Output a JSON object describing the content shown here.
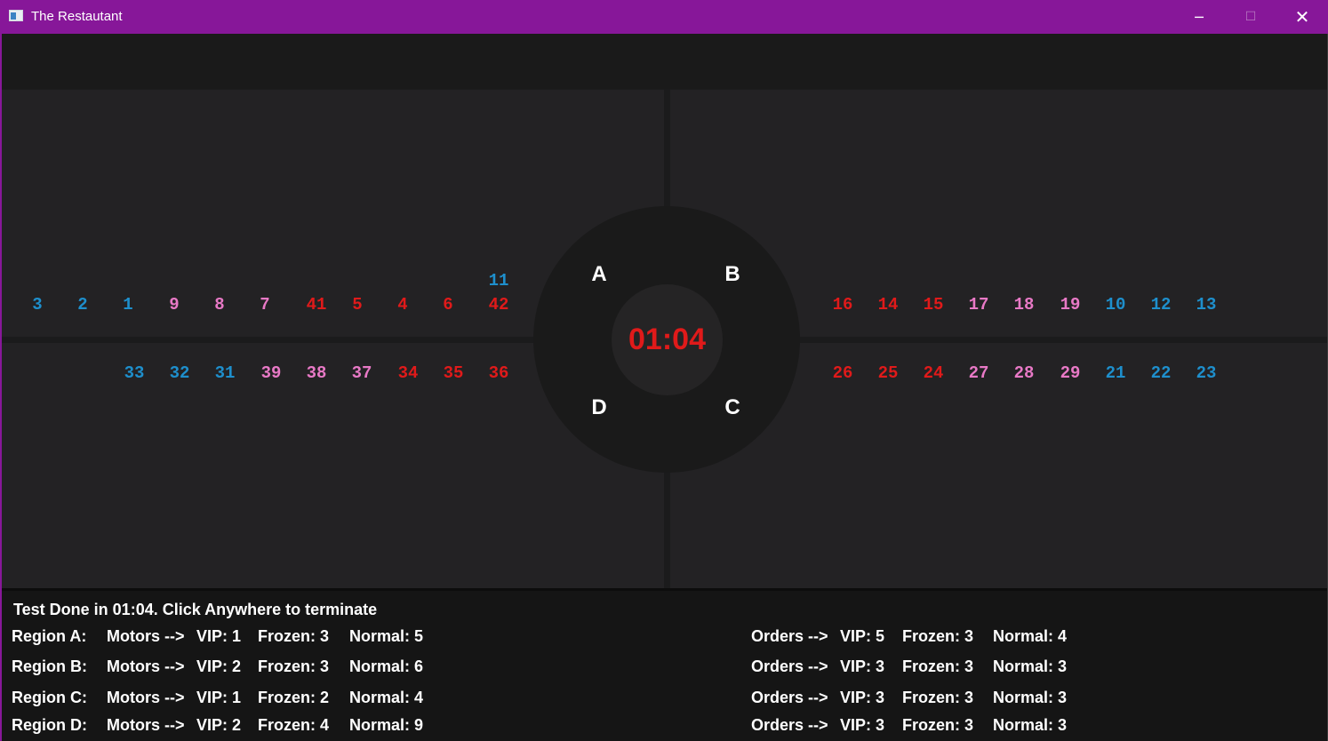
{
  "window": {
    "title": "The Restautant",
    "minimize_glyph": "─",
    "maximize_glyph": "☐",
    "close_glyph": "✕"
  },
  "colors": {
    "titlebar": "#871799",
    "vip": "#1e8fcc",
    "frozen": "#e879c6",
    "normal": "#e01a1a",
    "timer": "#e01a1a"
  },
  "timer": "01:04",
  "regions": {
    "a": "A",
    "b": "B",
    "c": "C",
    "d": "D"
  },
  "tables": {
    "top_left": [
      {
        "label": "3",
        "kind": "vip"
      },
      {
        "label": "2",
        "kind": "vip"
      },
      {
        "label": "1",
        "kind": "vip"
      },
      {
        "label": "9",
        "kind": "frozen"
      },
      {
        "label": "8",
        "kind": "frozen"
      },
      {
        "label": "7",
        "kind": "frozen"
      },
      {
        "label": "41",
        "kind": "normal"
      },
      {
        "label": "5",
        "kind": "normal"
      },
      {
        "label": "4",
        "kind": "normal"
      },
      {
        "label": "6",
        "kind": "normal"
      },
      {
        "label": "42",
        "kind": "normal"
      }
    ],
    "top_left_extra": {
      "label": "11",
      "kind": "vip"
    },
    "bottom_left": [
      {
        "label": "33",
        "kind": "vip"
      },
      {
        "label": "32",
        "kind": "vip"
      },
      {
        "label": "31",
        "kind": "vip"
      },
      {
        "label": "39",
        "kind": "frozen"
      },
      {
        "label": "38",
        "kind": "frozen"
      },
      {
        "label": "37",
        "kind": "frozen"
      },
      {
        "label": "34",
        "kind": "normal"
      },
      {
        "label": "35",
        "kind": "normal"
      },
      {
        "label": "36",
        "kind": "normal"
      }
    ],
    "top_right": [
      {
        "label": "16",
        "kind": "normal"
      },
      {
        "label": "14",
        "kind": "normal"
      },
      {
        "label": "15",
        "kind": "normal"
      },
      {
        "label": "17",
        "kind": "frozen"
      },
      {
        "label": "18",
        "kind": "frozen"
      },
      {
        "label": "19",
        "kind": "frozen"
      },
      {
        "label": "10",
        "kind": "vip"
      },
      {
        "label": "12",
        "kind": "vip"
      },
      {
        "label": "13",
        "kind": "vip"
      }
    ],
    "bottom_right": [
      {
        "label": "26",
        "kind": "normal"
      },
      {
        "label": "25",
        "kind": "normal"
      },
      {
        "label": "24",
        "kind": "normal"
      },
      {
        "label": "27",
        "kind": "frozen"
      },
      {
        "label": "28",
        "kind": "frozen"
      },
      {
        "label": "29",
        "kind": "frozen"
      },
      {
        "label": "21",
        "kind": "vip"
      },
      {
        "label": "22",
        "kind": "vip"
      },
      {
        "label": "23",
        "kind": "vip"
      }
    ]
  },
  "status": {
    "message": "Test Done in 01:04. Click Anywhere to terminate",
    "rows": [
      {
        "region": "Region A:",
        "motors": "Motors -->",
        "m_vip": "VIP: 1",
        "m_frozen": "Frozen: 3",
        "m_normal": "Normal: 5",
        "orders": "Orders -->",
        "o_vip": "VIP: 5",
        "o_frozen": "Frozen: 3",
        "o_normal": "Normal: 4"
      },
      {
        "region": "Region B:",
        "motors": "Motors -->",
        "m_vip": "VIP: 2",
        "m_frozen": "Frozen: 3",
        "m_normal": "Normal: 6",
        "orders": "Orders -->",
        "o_vip": "VIP: 3",
        "o_frozen": "Frozen: 3",
        "o_normal": "Normal: 3"
      },
      {
        "region": "Region C:",
        "motors": "Motors -->",
        "m_vip": "VIP: 1",
        "m_frozen": "Frozen: 2",
        "m_normal": "Normal: 4",
        "orders": "Orders -->",
        "o_vip": "VIP: 3",
        "o_frozen": "Frozen: 3",
        "o_normal": "Normal: 3"
      },
      {
        "region": "Region D:",
        "motors": "Motors -->",
        "m_vip": "VIP: 2",
        "m_frozen": "Frozen: 4",
        "m_normal": "Normal: 9",
        "orders": "Orders -->",
        "o_vip": "VIP: 3",
        "o_frozen": "Frozen: 3",
        "o_normal": "Normal: 3"
      }
    ]
  }
}
